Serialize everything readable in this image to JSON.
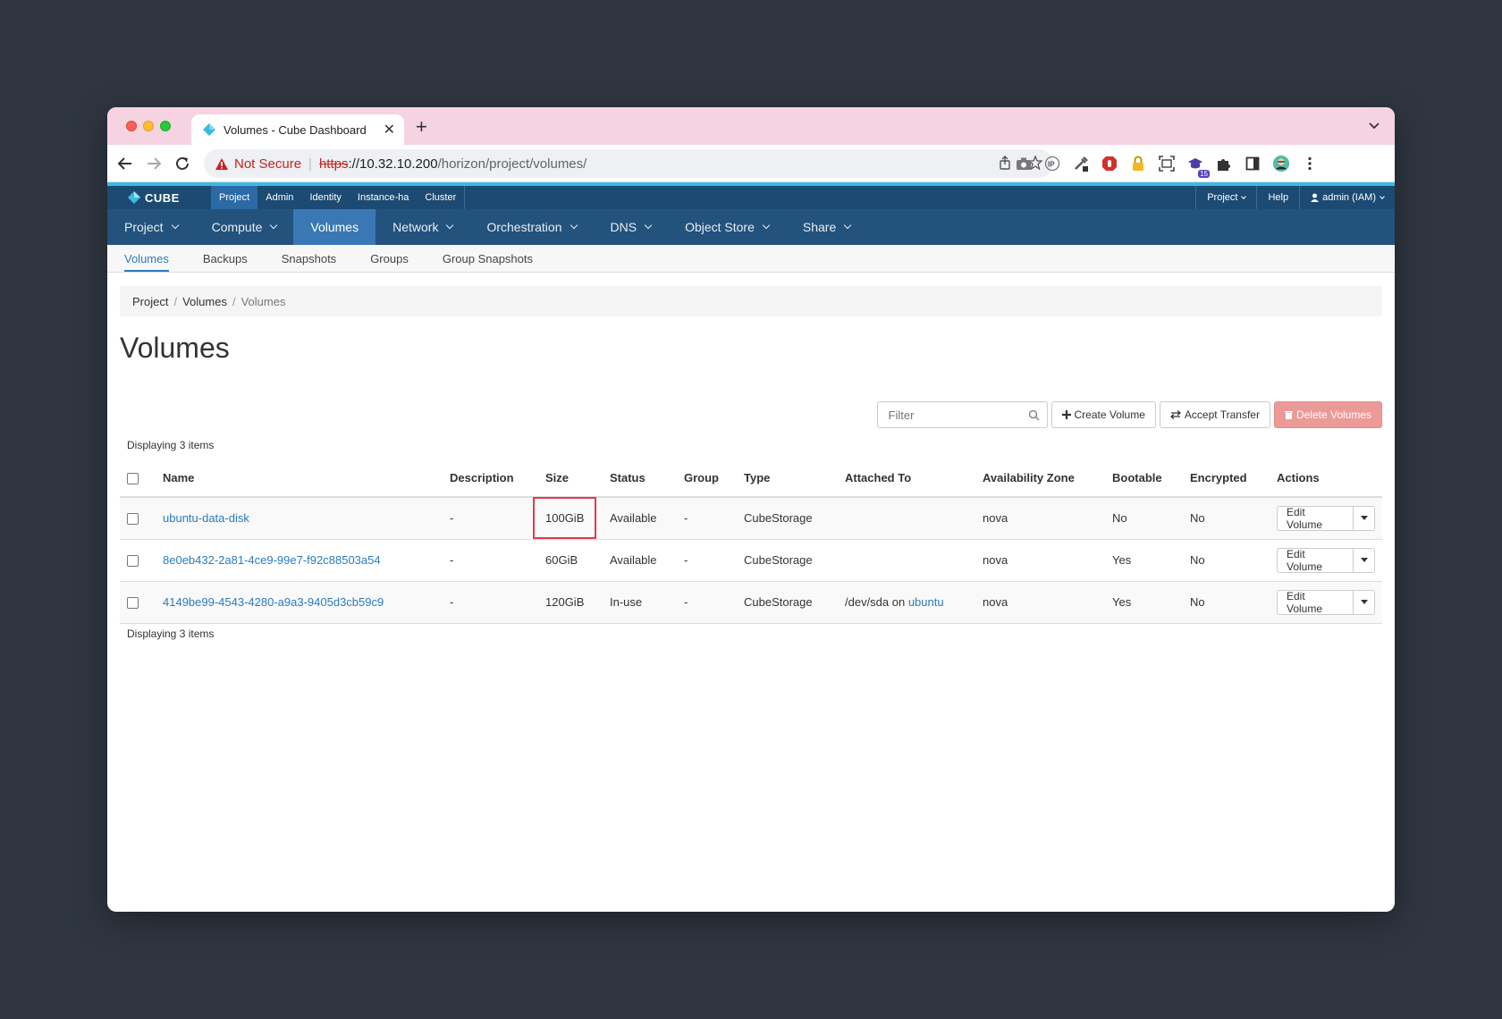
{
  "browser": {
    "tab_title": "Volumes - Cube Dashboard",
    "not_secure": "Not Secure",
    "url_scheme": "https",
    "url_host": "://10.32.10.200",
    "url_path": "/horizon/project/volumes/",
    "ext_badge": "15"
  },
  "topbar": {
    "logo_text": "CUBE",
    "tabs": [
      "Project",
      "Admin",
      "Identity",
      "Instance-ha",
      "Cluster"
    ],
    "right": {
      "project": "Project",
      "help": "Help",
      "user": "admin (IAM)"
    }
  },
  "mainnav": [
    "Project",
    "Compute",
    "Volumes",
    "Network",
    "Orchestration",
    "DNS",
    "Object Store",
    "Share"
  ],
  "subnav": [
    "Volumes",
    "Backups",
    "Snapshots",
    "Groups",
    "Group Snapshots"
  ],
  "breadcrumb": [
    "Project",
    "Volumes",
    "Volumes"
  ],
  "page_title": "Volumes",
  "toolbar": {
    "filter_placeholder": "Filter",
    "create": "Create Volume",
    "accept": "Accept Transfer",
    "delete": "Delete Volumes"
  },
  "display_count": "Displaying 3 items",
  "table": {
    "headers": [
      "Name",
      "Description",
      "Size",
      "Status",
      "Group",
      "Type",
      "Attached To",
      "Availability Zone",
      "Bootable",
      "Encrypted",
      "Actions"
    ],
    "rows": [
      {
        "name": "ubuntu-data-disk",
        "description": "-",
        "size": "100GiB",
        "status": "Available",
        "group": "-",
        "type": "CubeStorage",
        "attached_prefix": "",
        "attached_link": "",
        "zone": "nova",
        "bootable": "No",
        "encrypted": "No",
        "action": "Edit Volume"
      },
      {
        "name": "8e0eb432-2a81-4ce9-99e7-f92c88503a54",
        "description": "-",
        "size": "60GiB",
        "status": "Available",
        "group": "-",
        "type": "CubeStorage",
        "attached_prefix": "",
        "attached_link": "",
        "zone": "nova",
        "bootable": "Yes",
        "encrypted": "No",
        "action": "Edit Volume"
      },
      {
        "name": "4149be99-4543-4280-a9a3-9405d3cb59c9",
        "description": "-",
        "size": "120GiB",
        "status": "In-use",
        "group": "-",
        "type": "CubeStorage",
        "attached_prefix": "/dev/sda on ",
        "attached_link": "ubuntu",
        "zone": "nova",
        "bootable": "Yes",
        "encrypted": "No",
        "action": "Edit Volume"
      }
    ]
  }
}
